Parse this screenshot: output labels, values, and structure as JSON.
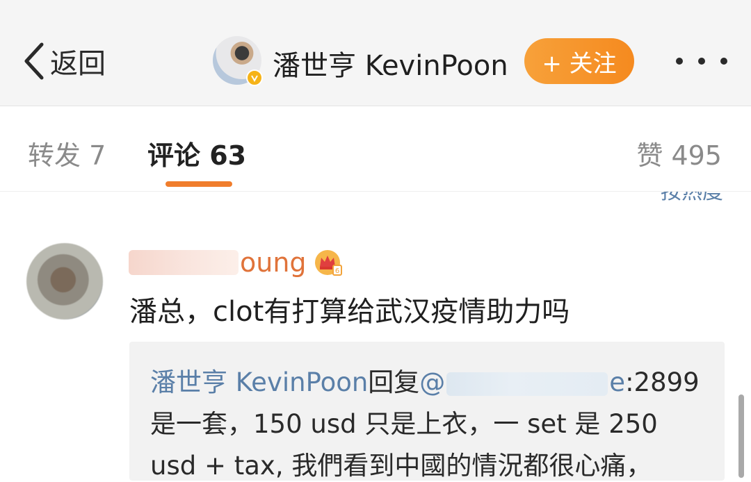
{
  "header": {
    "back_label": "返回",
    "user_name": "潘世亨 KevinPoon",
    "follow_label": "+ 关注"
  },
  "tabs": {
    "repost": "转发 7",
    "comments": "评论 63",
    "likes": "赞 495"
  },
  "sort_label": "按热度",
  "comment": {
    "author_visible": "oung",
    "text": "潘总，clot有打算给武汉疫情助力吗",
    "reply": {
      "author": "潘世亨 KevinPoon",
      "verb": "回复",
      "mention_start": "@",
      "mention_end": "e",
      "line1_rest": ":2899",
      "line2": "是一套，150 usd 只是上衣，一 set 是 250",
      "line3": "usd + tax, 我們看到中國的情況都很心痛，"
    }
  },
  "colors": {
    "accent_orange": "#f07d2c",
    "follow_button": "#f58a1f",
    "link_blue": "#5a7fa8",
    "username_orange": "#e0733a"
  },
  "icons": [
    "back-chevron-icon",
    "verified-badge-icon",
    "more-icon",
    "vip-crown-icon"
  ]
}
